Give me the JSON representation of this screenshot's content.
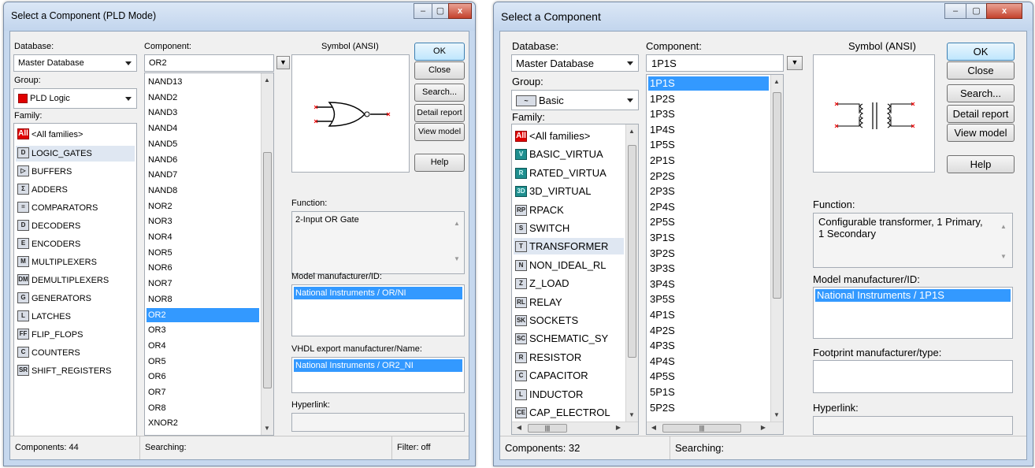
{
  "left": {
    "title": "Select a Component (PLD Mode)",
    "controls": {
      "minimize": "–",
      "maximize": "▢",
      "close": "x"
    },
    "database_label": "Database:",
    "database_value": "Master Database",
    "group_label": "Group:",
    "group_value": "PLD Logic",
    "family_label": "Family:",
    "families": [
      {
        "icon": "All",
        "label": "<All families>"
      },
      {
        "icon": "D",
        "label": "LOGIC_GATES"
      },
      {
        "icon": "▷",
        "label": "BUFFERS"
      },
      {
        "icon": "Σ",
        "label": "ADDERS"
      },
      {
        "icon": "=",
        "label": "COMPARATORS"
      },
      {
        "icon": "D",
        "label": "DECODERS"
      },
      {
        "icon": "E",
        "label": "ENCODERS"
      },
      {
        "icon": "M",
        "label": "MULTIPLEXERS"
      },
      {
        "icon": "DM",
        "label": "DEMULTIPLEXERS"
      },
      {
        "icon": "G",
        "label": "GENERATORS"
      },
      {
        "icon": "L",
        "label": "LATCHES"
      },
      {
        "icon": "FF",
        "label": "FLIP_FLOPS"
      },
      {
        "icon": "C",
        "label": "COUNTERS"
      },
      {
        "icon": "SR",
        "label": "SHIFT_REGISTERS"
      }
    ],
    "component_label": "Component:",
    "component_value": "OR2",
    "components": [
      "NAND13",
      "NAND2",
      "NAND3",
      "NAND4",
      "NAND5",
      "NAND6",
      "NAND7",
      "NAND8",
      "NOR2",
      "NOR3",
      "NOR4",
      "NOR5",
      "NOR6",
      "NOR7",
      "NOR8",
      "OR2",
      "OR3",
      "OR4",
      "OR5",
      "OR6",
      "OR7",
      "OR8",
      "XNOR2"
    ],
    "symbol_label": "Symbol (ANSI)",
    "function_label": "Function:",
    "function_value": "2-Input OR Gate",
    "model_label": "Model manufacturer/ID:",
    "model_value": "National Instruments / OR/NI",
    "vhdl_label": "VHDL export manufacturer/Name:",
    "vhdl_value": "National Instruments / OR2_NI",
    "hyperlink_label": "Hyperlink:",
    "buttons": [
      "OK",
      "Close",
      "Search...",
      "Detail report",
      "View model",
      "Help"
    ],
    "status": {
      "components": "Components: 44",
      "searching": "Searching:",
      "filter": "Filter: off"
    }
  },
  "right": {
    "title": "Select a Component",
    "controls": {
      "minimize": "–",
      "maximize": "▢",
      "close": "x"
    },
    "database_label": "Database:",
    "database_value": "Master Database",
    "group_label": "Group:",
    "group_value": "Basic",
    "family_label": "Family:",
    "families": [
      {
        "icon": "All",
        "label": "<All families>"
      },
      {
        "icon": "V",
        "label": "BASIC_VIRTUA"
      },
      {
        "icon": "R",
        "label": "RATED_VIRTUA"
      },
      {
        "icon": "3D",
        "label": "3D_VIRTUAL"
      },
      {
        "icon": "RP",
        "label": "RPACK"
      },
      {
        "icon": "S",
        "label": "SWITCH"
      },
      {
        "icon": "T",
        "label": "TRANSFORMER"
      },
      {
        "icon": "N",
        "label": "NON_IDEAL_RL"
      },
      {
        "icon": "Z",
        "label": "Z_LOAD"
      },
      {
        "icon": "RL",
        "label": "RELAY"
      },
      {
        "icon": "SK",
        "label": "SOCKETS"
      },
      {
        "icon": "SC",
        "label": "SCHEMATIC_SY"
      },
      {
        "icon": "R",
        "label": "RESISTOR"
      },
      {
        "icon": "C",
        "label": "CAPACITOR"
      },
      {
        "icon": "L",
        "label": "INDUCTOR"
      },
      {
        "icon": "CE",
        "label": "CAP_ELECTROL"
      }
    ],
    "component_label": "Component:",
    "component_value": "1P1S",
    "components": [
      "1P1S",
      "1P2S",
      "1P3S",
      "1P4S",
      "1P5S",
      "2P1S",
      "2P2S",
      "2P3S",
      "2P4S",
      "2P5S",
      "3P1S",
      "3P2S",
      "3P3S",
      "3P4S",
      "3P5S",
      "4P1S",
      "4P2S",
      "4P3S",
      "4P4S",
      "4P5S",
      "5P1S",
      "5P2S"
    ],
    "symbol_label": "Symbol (ANSI)",
    "function_label": "Function:",
    "function_value": "Configurable transformer, 1 Primary, 1 Secondary",
    "model_label": "Model manufacturer/ID:",
    "model_value": "National Instruments / 1P1S",
    "footprint_label": "Footprint manufacturer/type:",
    "hyperlink_label": "Hyperlink:",
    "buttons": [
      "OK",
      "Close",
      "Search...",
      "Detail report",
      "View model",
      "Help"
    ],
    "status": {
      "components": "Components: 32",
      "searching": "Searching:"
    }
  }
}
